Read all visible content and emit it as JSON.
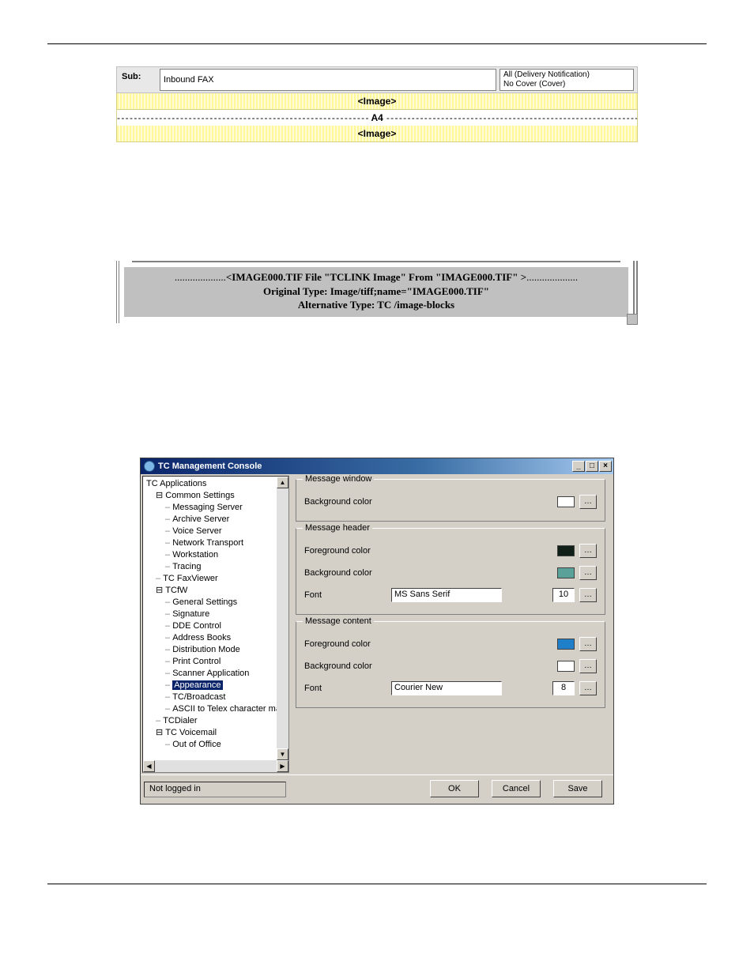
{
  "fig1": {
    "sub_label": "Sub:",
    "sub_value": "Inbound FAX",
    "right_line1": "All   (Delivery Notification)",
    "right_line2": "No Cover   (Cover)",
    "image_tag": "<Image>",
    "a4_label": "A4"
  },
  "fig2": {
    "line1": "<IMAGE000.TIF File \"TCLINK Image\" From \"IMAGE000.TIF\" >",
    "line2": "Original Type: Image/tiff;name=\"IMAGE000.TIF\"",
    "line3": "Alternative Type: TC /image-blocks"
  },
  "fig3": {
    "title": "TC Management Console",
    "tree": {
      "root": "TC Applications",
      "common": "Common Settings",
      "common_items": [
        "Messaging Server",
        "Archive Server",
        "Voice Server",
        "Network Transport",
        "Workstation",
        "Tracing"
      ],
      "faxviewer": "TC FaxViewer",
      "tcfw": "TCfW",
      "tcfw_items": [
        "General Settings",
        "Signature",
        "DDE Control",
        "Address Books",
        "Distribution Mode",
        "Print Control",
        "Scanner Application",
        "Appearance",
        "TC/Broadcast",
        "ASCII to Telex character mappin"
      ],
      "tcdialer": "TCDialer",
      "voicemail": "TC Voicemail",
      "voicemail_items": [
        "Out of Office"
      ]
    },
    "groups": {
      "msg_window": {
        "legend": "Message window",
        "bg": "Background color"
      },
      "msg_header": {
        "legend": "Message header",
        "fg": "Foreground color",
        "bg": "Background color",
        "font_label": "Font",
        "font_value": "MS Sans Serif",
        "font_size": "10"
      },
      "msg_content": {
        "legend": "Message content",
        "fg": "Foreground color",
        "bg": "Background color",
        "font_label": "Font",
        "font_value": "Courier New",
        "font_size": "8"
      }
    },
    "status": "Not logged in",
    "buttons": {
      "ok": "OK",
      "cancel": "Cancel",
      "save": "Save"
    }
  }
}
